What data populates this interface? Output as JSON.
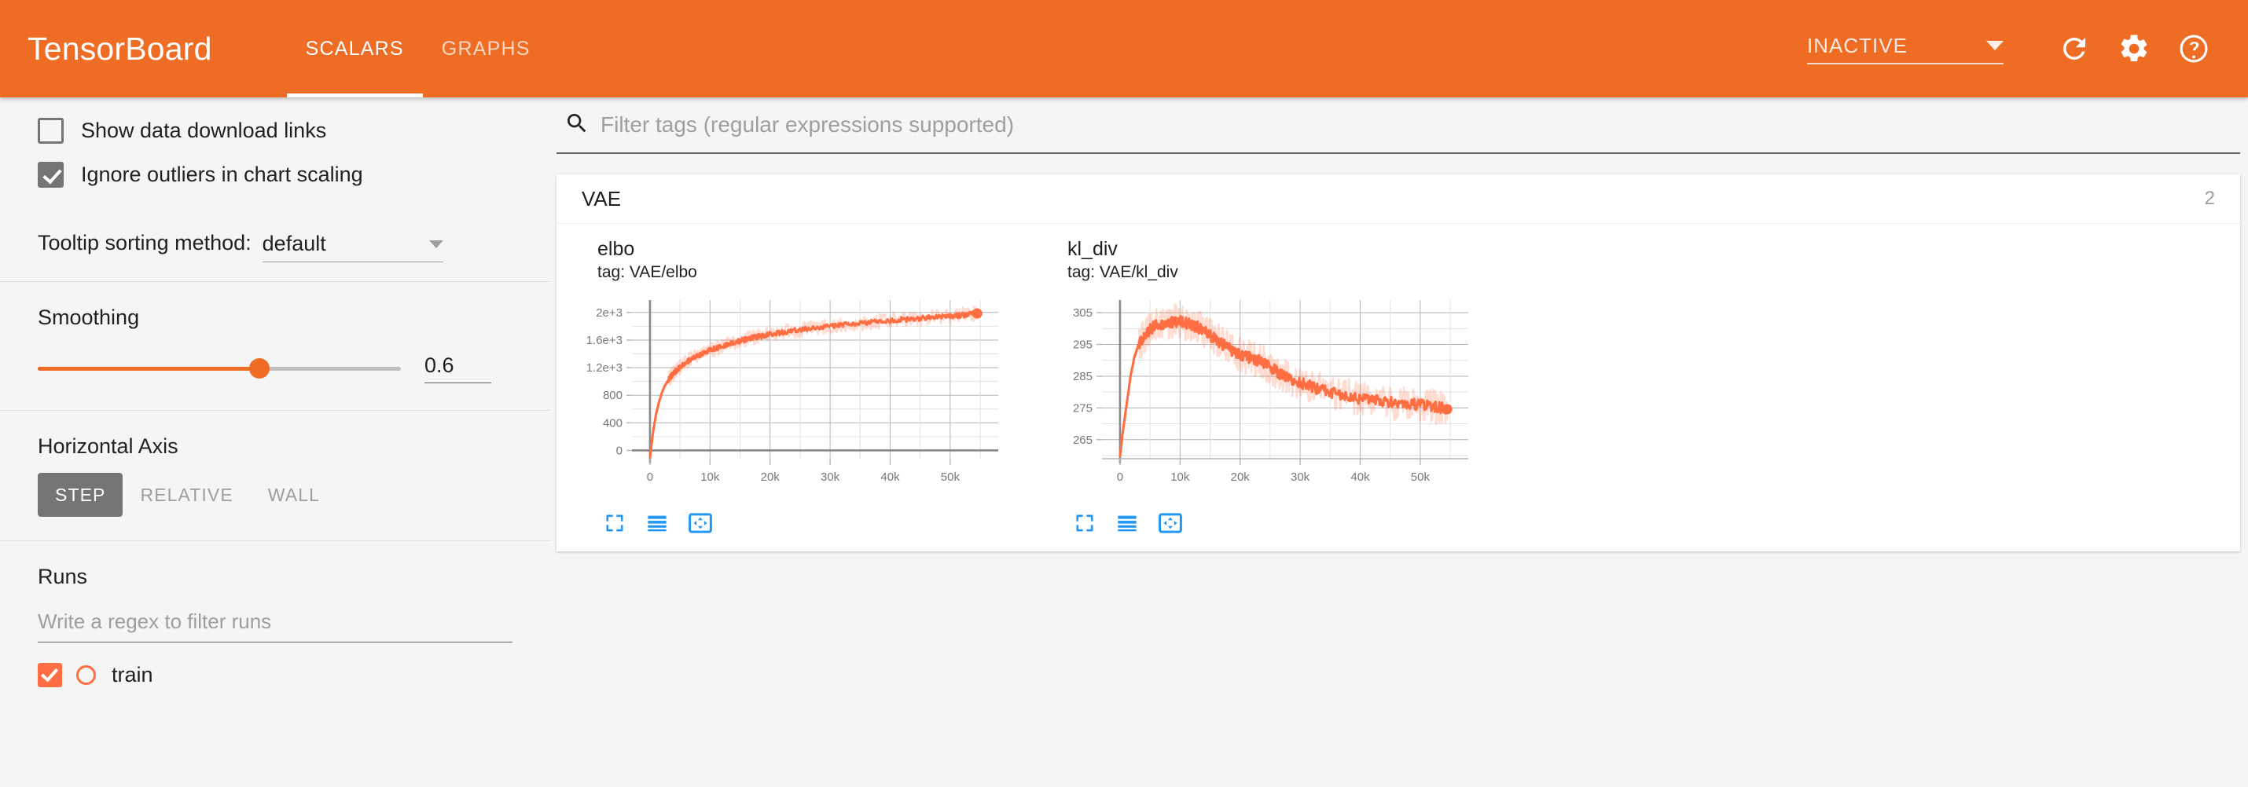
{
  "header": {
    "brand": "TensorBoard",
    "tabs": [
      {
        "label": "SCALARS",
        "active": true
      },
      {
        "label": "GRAPHS",
        "active": false
      }
    ],
    "status_value": "INACTIVE",
    "icons": [
      "refresh-icon",
      "gear-icon",
      "help-icon"
    ],
    "background_color": "#ef6c25"
  },
  "sidebar": {
    "show_download_links": {
      "label": "Show data download links",
      "checked": false
    },
    "ignore_outliers": {
      "label": "Ignore outliers in chart scaling",
      "checked": true
    },
    "tooltip_sorting": {
      "label": "Tooltip sorting method:",
      "value": "default"
    },
    "smoothing": {
      "label": "Smoothing",
      "value": "0.6",
      "fraction": 0.61
    },
    "horizontal_axis": {
      "label": "Horizontal Axis",
      "options": [
        {
          "label": "STEP",
          "active": true
        },
        {
          "label": "RELATIVE",
          "active": false
        },
        {
          "label": "WALL",
          "active": false
        }
      ]
    },
    "runs": {
      "label": "Runs",
      "filter_placeholder": "Write a regex to filter runs",
      "items": [
        {
          "name": "train",
          "checked": true,
          "color": "#ff6e42"
        }
      ]
    }
  },
  "main": {
    "filter_placeholder": "Filter tags (regular expressions supported)",
    "card": {
      "title": "VAE",
      "count": "2"
    },
    "chart_icons": [
      "expand-icon",
      "data-lines-icon",
      "reset-axis-icon"
    ]
  },
  "chart_data": [
    {
      "type": "line",
      "title": "elbo",
      "tag": "tag: VAE/elbo",
      "xlabel": "",
      "ylabel": "",
      "xlim": [
        -3000,
        58000
      ],
      "ylim": [
        -120,
        2180
      ],
      "xticks": [
        0,
        10000,
        20000,
        30000,
        40000,
        50000
      ],
      "xticklabels": [
        "0",
        "10k",
        "20k",
        "30k",
        "40k",
        "50k"
      ],
      "yticks": [
        0,
        400,
        800,
        1200,
        1600,
        2000
      ],
      "yticklabels": [
        "0",
        "400",
        "800",
        "1.2e+3",
        "1.6e+3",
        "2e+3"
      ],
      "grid": true,
      "legend": "none",
      "series": [
        {
          "name": "train",
          "color": "#ff6e42",
          "x": [
            0,
            500,
            1000,
            1500,
            2000,
            2500,
            3000,
            3500,
            4000,
            4500,
            5000,
            6000,
            7000,
            8000,
            9000,
            10000,
            11000,
            12000,
            13000,
            14000,
            15000,
            16000,
            17000,
            18000,
            19000,
            20000,
            22000,
            24000,
            26000,
            28000,
            30000,
            32000,
            34000,
            36000,
            38000,
            40000,
            42000,
            44000,
            46000,
            48000,
            50000,
            52000,
            53500,
            54500
          ],
          "values": [
            -110,
            260,
            520,
            700,
            840,
            940,
            1010,
            1075,
            1120,
            1165,
            1205,
            1280,
            1330,
            1375,
            1415,
            1450,
            1480,
            1510,
            1540,
            1560,
            1590,
            1610,
            1630,
            1650,
            1665,
            1680,
            1710,
            1735,
            1760,
            1780,
            1800,
            1820,
            1838,
            1855,
            1868,
            1880,
            1895,
            1910,
            1922,
            1935,
            1948,
            1962,
            1975,
            1985
          ]
        }
      ],
      "last_point": {
        "x": 54500,
        "y": 1985
      }
    },
    {
      "type": "line",
      "title": "kl_div",
      "tag": "tag: VAE/kl_div",
      "xlabel": "",
      "ylabel": "",
      "xlim": [
        -3000,
        58000
      ],
      "ylim": [
        259,
        309
      ],
      "xticks": [
        0,
        10000,
        20000,
        30000,
        40000,
        50000
      ],
      "xticklabels": [
        "0",
        "10k",
        "20k",
        "30k",
        "40k",
        "50k"
      ],
      "yticks": [
        265,
        275,
        285,
        295,
        305
      ],
      "yticklabels": [
        "265",
        "275",
        "285",
        "295",
        "305"
      ],
      "grid": true,
      "legend": "none",
      "series": [
        {
          "name": "train",
          "color": "#ff6e42",
          "x": [
            0,
            400,
            800,
            1200,
            1800,
            2400,
            3000,
            3600,
            4400,
            5200,
            6000,
            7000,
            8000,
            9000,
            10000,
            11000,
            12000,
            13000,
            14000,
            15000,
            16000,
            17000,
            18000,
            19000,
            20000,
            21000,
            22000,
            23000,
            24000,
            25000,
            26000,
            27000,
            28000,
            30000,
            32000,
            34000,
            36000,
            38000,
            40000,
            42000,
            44000,
            46000,
            48000,
            50000,
            52000,
            53500,
            54500
          ],
          "values": [
            259.5,
            266.5,
            272.0,
            277.5,
            285.5,
            291.0,
            294.5,
            296.5,
            298.5,
            300.0,
            301.0,
            301.5,
            301.8,
            302.2,
            302.6,
            301.8,
            301.2,
            300.4,
            299.4,
            297.8,
            296.4,
            295.2,
            293.8,
            292.8,
            292.0,
            291.2,
            290.8,
            290.0,
            289.0,
            288.0,
            286.6,
            285.4,
            284.6,
            283.0,
            281.6,
            280.4,
            279.6,
            278.8,
            278.0,
            277.4,
            277.0,
            276.6,
            276.2,
            276.0,
            275.4,
            275.0,
            274.6
          ]
        }
      ],
      "last_point": {
        "x": 54500,
        "y": 274.6
      }
    }
  ]
}
